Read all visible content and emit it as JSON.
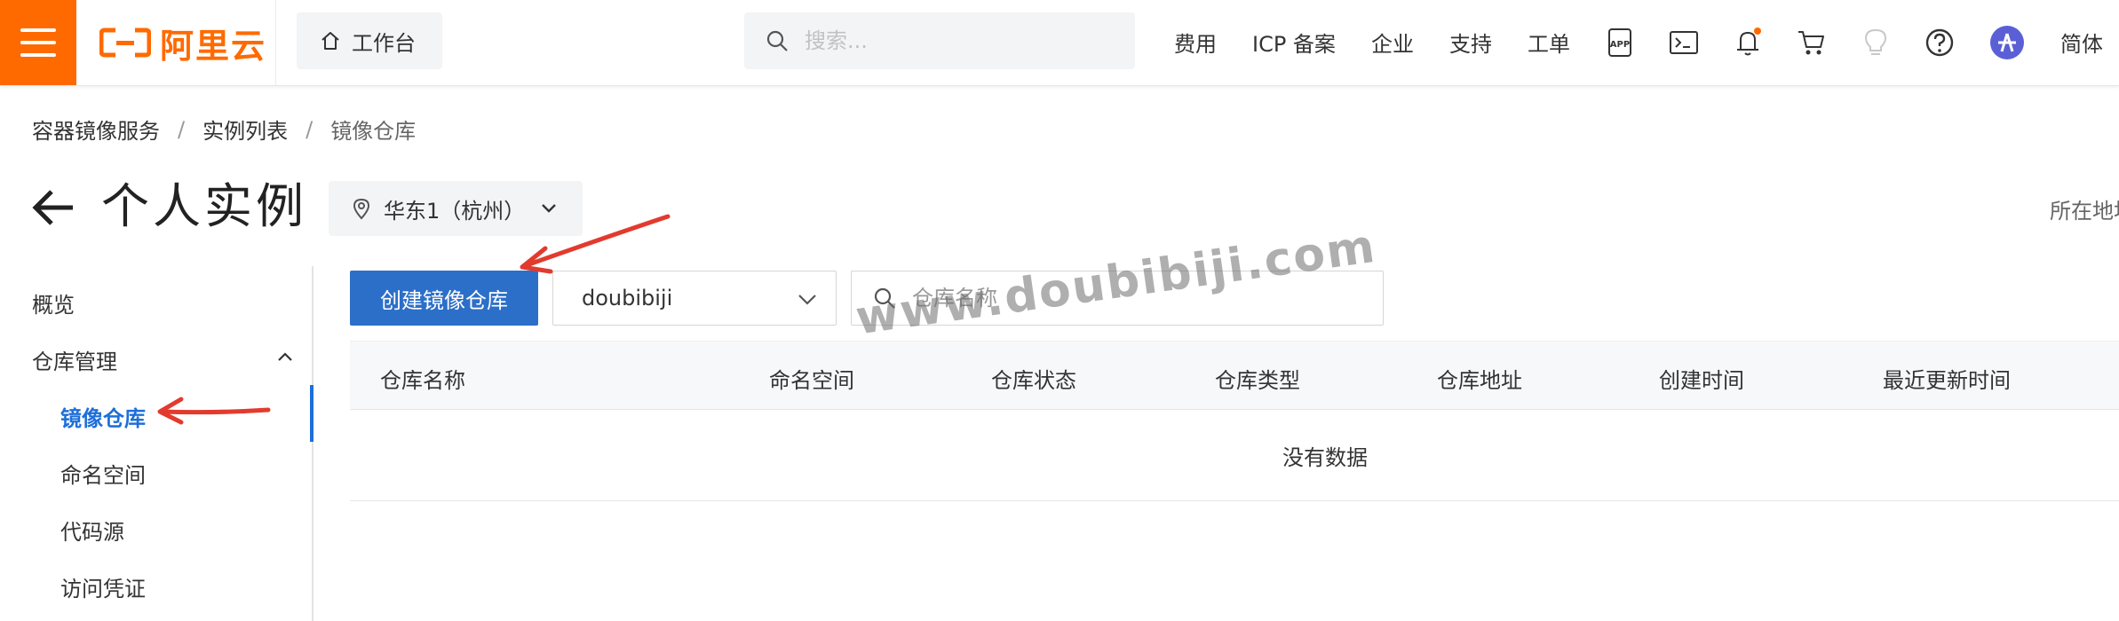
{
  "topbar": {
    "logo_text": "阿里云",
    "workbench_label": "工作台",
    "search_placeholder": "搜索...",
    "nav": [
      "费用",
      "ICP 备案",
      "企业",
      "支持",
      "工单"
    ],
    "icons": [
      "app-icon",
      "terminal-icon",
      "bell-icon",
      "cart-icon",
      "bulb-icon",
      "help-icon",
      "avatar"
    ],
    "notification_dot_color": "#ff6a00",
    "language": "简体"
  },
  "breadcrumb": [
    "容器镜像服务",
    "实例列表",
    "镜像仓库"
  ],
  "title": {
    "text": "个人实例",
    "region": "华东1（杭州）",
    "right_label": "所在地址"
  },
  "sidebar": {
    "items": [
      {
        "label": "概览"
      },
      {
        "label": "仓库管理"
      },
      {
        "label": "镜像仓库"
      },
      {
        "label": "命名空间"
      },
      {
        "label": "代码源"
      },
      {
        "label": "访问凭证"
      }
    ]
  },
  "toolbar": {
    "create_label": "创建镜像仓库",
    "namespace_value": "doubibiji",
    "search_placeholder": "仓库名称"
  },
  "table": {
    "columns": [
      "仓库名称",
      "命名空间",
      "仓库状态",
      "仓库类型",
      "仓库地址",
      "创建时间",
      "最近更新时间"
    ],
    "empty_text": "没有数据"
  },
  "watermark": "www.doubibiji.com",
  "colors": {
    "brand": "#ff6a00",
    "primary_button": "#2c6fc9",
    "active_nav": "#1e6fd9",
    "annotation_arrow": "#e23b2e"
  }
}
